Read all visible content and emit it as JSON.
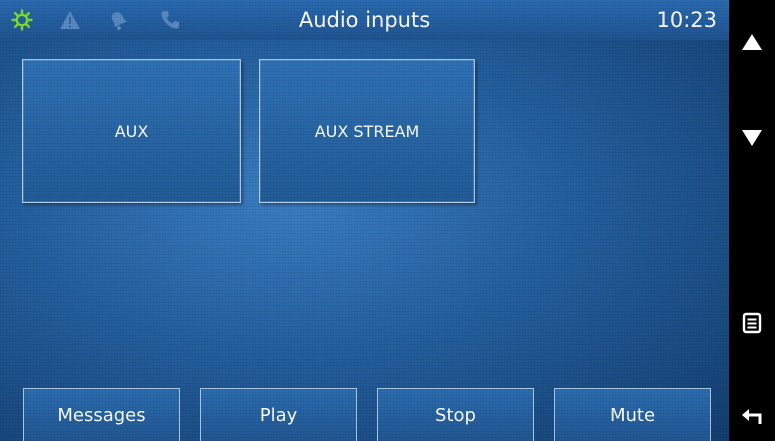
{
  "status_bar": {
    "title": "Audio inputs",
    "clock": "10:23",
    "icons": [
      "gear-icon",
      "warning-icon",
      "bell-icon",
      "phone-icon"
    ]
  },
  "sources": [
    {
      "label": "AUX"
    },
    {
      "label": "AUX STREAM"
    }
  ],
  "softkeys": [
    {
      "label": "Messages"
    },
    {
      "label": "Play"
    },
    {
      "label": "Stop"
    },
    {
      "label": "Mute"
    }
  ],
  "side_controls": [
    "up-arrow-icon",
    "down-arrow-icon",
    "menu-icon",
    "back-icon"
  ],
  "colors": {
    "accent_green": "#7ddf2a",
    "inactive_icon": "#5b8ac0",
    "background": "#24609f"
  }
}
